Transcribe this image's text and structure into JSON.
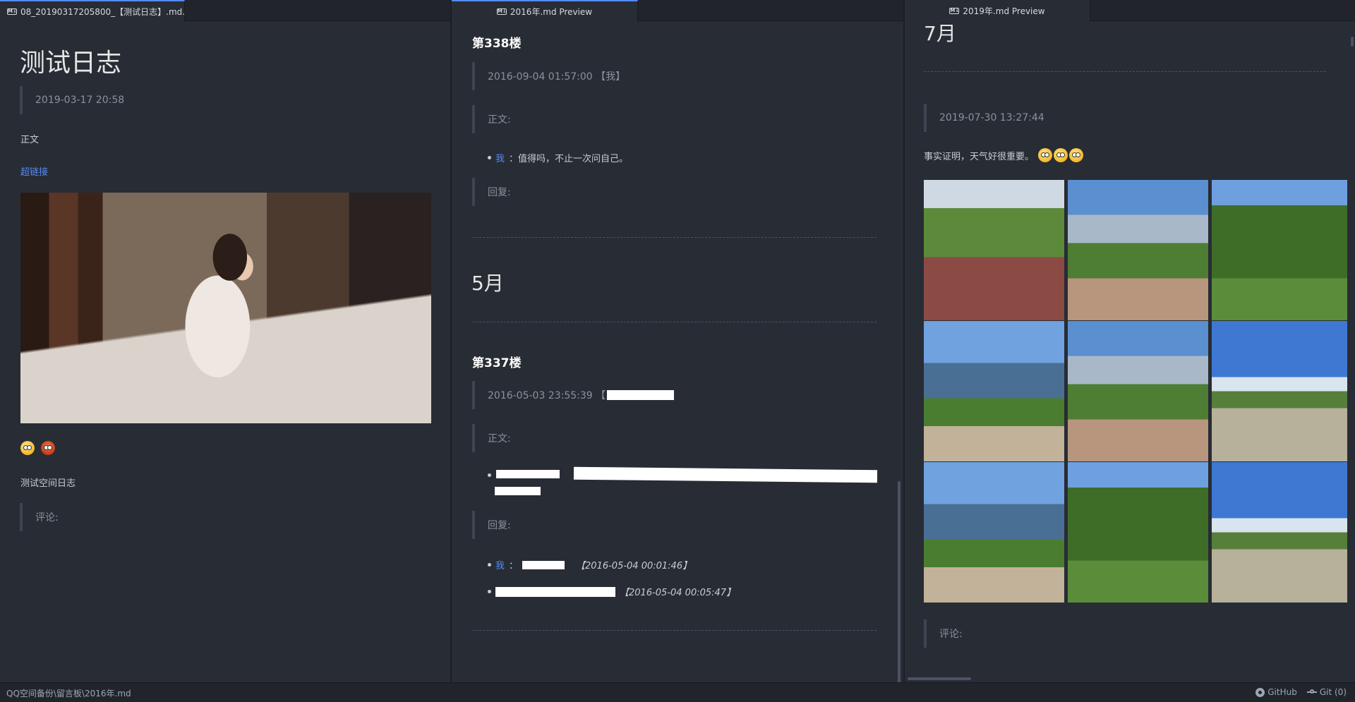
{
  "left": {
    "tab_title": "08_20190317205800_【测试日志】.md...",
    "title": "测试日志",
    "date": "2019-03-17 20:58",
    "body_label": "正文",
    "link_text": "超链接",
    "text": "测试空间日志",
    "comment_label": "评论:"
  },
  "middle": {
    "tab_title": "2016年.md Preview",
    "floor_338": "第338楼",
    "meta_338": "2016-09-04 01:57:00 【我】",
    "body_label_1": "正文:",
    "reply_338_who": "我",
    "reply_338_text": "：值得吗，不止一次问自己。",
    "reply_label_1": "回复:",
    "month": "5月",
    "floor_337": "第337楼",
    "meta_337": "2016-05-03 23:55:39 【",
    "body_label_2": "正文:",
    "reply_label_2": "回复:",
    "reply_337_1_who": "我",
    "reply_337_1_time": "【2016-05-04 00:01:46】",
    "reply_337_2_time": "【2016-05-04 00:05:47】"
  },
  "right": {
    "tab_title": "2019年.md Preview",
    "month": "7月",
    "date": "2019-07-30 13:27:44",
    "text": "事实证明，天气好很重要。",
    "comment_label": "评论:"
  },
  "statusbar": {
    "path": "QQ空间备份\\留言板\\2016年.md",
    "github": "GitHub",
    "git": "Git (0)"
  },
  "icons": [
    "md-preview-icon",
    "github-icon",
    "git-icon",
    "emoji-face-icon"
  ],
  "colors": {
    "editor_bg": "#282c34",
    "chrome_bg": "#21252b",
    "link": "#568af2"
  }
}
